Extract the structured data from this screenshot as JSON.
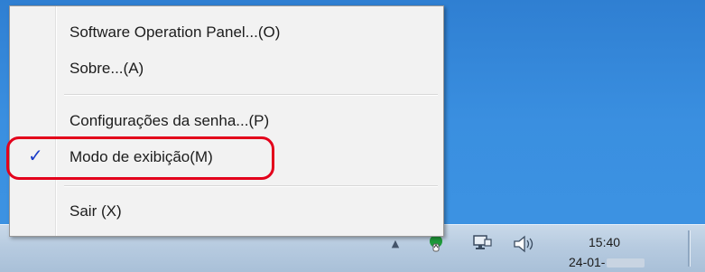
{
  "context_menu": {
    "items": [
      {
        "label": "Software Operation Panel...(O)",
        "checked": false
      },
      {
        "label": "Sobre...(A)",
        "checked": false
      },
      {
        "label": "Configurações da senha...(P)",
        "checked": false
      },
      {
        "label": "Modo de exibição(M)",
        "checked": true
      },
      {
        "label": "Sair (X)",
        "checked": false
      }
    ],
    "check_mark": "✓",
    "highlight_color": "#e3001b"
  },
  "taskbar": {
    "tray_icons": [
      "show-hidden-icons-arrow",
      "scanner-icon",
      "network-icon",
      "volume-icon"
    ],
    "tray_arrow_glyph": "▲",
    "clock": {
      "time": "15:40",
      "date_visible": "24-01-"
    }
  },
  "colors": {
    "desktop": "#3a8fe0",
    "taskbar": "#b7cbe0",
    "menu_background": "#f2f2f2"
  }
}
